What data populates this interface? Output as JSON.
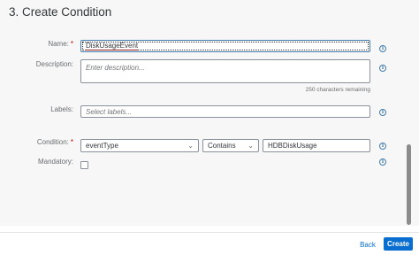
{
  "dialog": {
    "title": "3. Create Condition"
  },
  "form": {
    "name": {
      "label": "Name:",
      "required_mark": "*",
      "value": "DiskUsageEvent"
    },
    "description": {
      "label": "Description:",
      "placeholder": "Enter description...",
      "counter": "250 characters remaining"
    },
    "labels": {
      "label": "Labels:",
      "placeholder": "Select labels..."
    },
    "condition": {
      "label": "Condition:",
      "required_mark": "*",
      "field": "eventType",
      "operator": "Contains",
      "value": "HDBDiskUsage"
    },
    "mandatory": {
      "label": "Mandatory:",
      "checked": false
    }
  },
  "footer": {
    "back_label": "Back",
    "create_label": "Create"
  },
  "icons": {
    "info": "info-icon",
    "dropdown": "chevron-down-icon"
  },
  "colors": {
    "accent": "#0a6ed1",
    "required": "#bb0000",
    "background": "#f7f7f7"
  }
}
